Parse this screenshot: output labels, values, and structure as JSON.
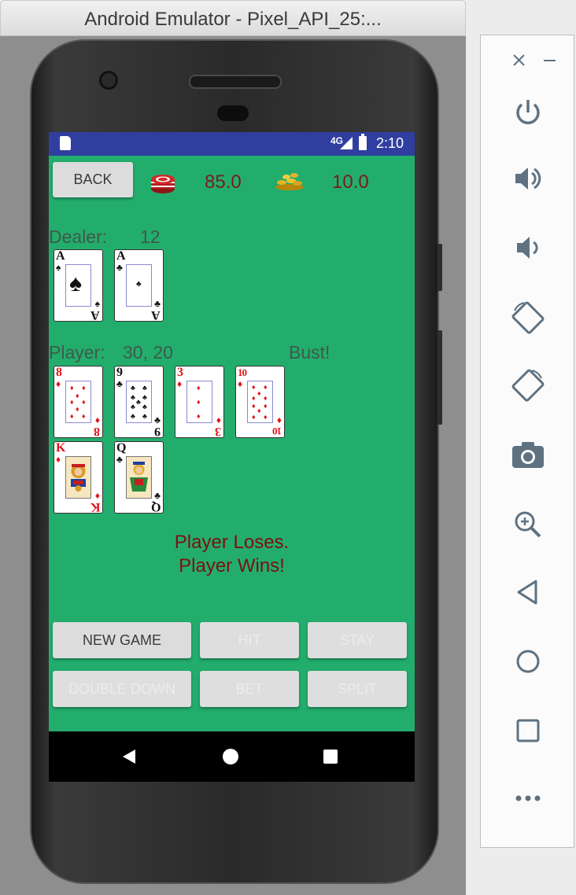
{
  "window": {
    "title": "Android Emulator - Pixel_API_25:..."
  },
  "statusbar": {
    "network": "4G",
    "time": "2:10"
  },
  "header": {
    "back_label": "BACK",
    "bank_value": "85.0",
    "bet_value": "10.0"
  },
  "dealer": {
    "label": "Dealer:",
    "score": "12",
    "cards": [
      {
        "rank": "A",
        "suit": "♠",
        "color": "black"
      },
      {
        "rank": "A",
        "suit": "♣",
        "color": "black"
      }
    ]
  },
  "player": {
    "label": "Player:",
    "score": "30, 20",
    "status": "Bust!",
    "cards": [
      {
        "rank": "8",
        "suit": "♦",
        "color": "red"
      },
      {
        "rank": "9",
        "suit": "♣",
        "color": "black"
      },
      {
        "rank": "3",
        "suit": "♦",
        "color": "red"
      },
      {
        "rank": "10",
        "suit": "♦",
        "color": "red"
      },
      {
        "rank": "K",
        "suit": "♦",
        "color": "red"
      },
      {
        "rank": "Q",
        "suit": "♣",
        "color": "black"
      }
    ]
  },
  "messages": {
    "line1": "Player Loses.",
    "line2": "Player Wins!"
  },
  "buttons": {
    "new_game": "NEW GAME",
    "hit": "HIT",
    "stay": "STAY",
    "double_down": "DOUBLE DOWN",
    "bet": "BET",
    "split": "SPLIT"
  },
  "colors": {
    "table": "#23ad6d",
    "statusbar": "#303f9f",
    "value_text": "#7b1b1b",
    "message_text": "#7b1010"
  },
  "emulator_panel": {
    "icons": [
      "close-icon",
      "minimize-icon",
      "power-icon",
      "volume-up-icon",
      "volume-down-icon",
      "rotate-left-icon",
      "rotate-right-icon",
      "camera-icon",
      "zoom-icon",
      "back-icon",
      "home-icon",
      "overview-icon",
      "more-icon"
    ]
  }
}
